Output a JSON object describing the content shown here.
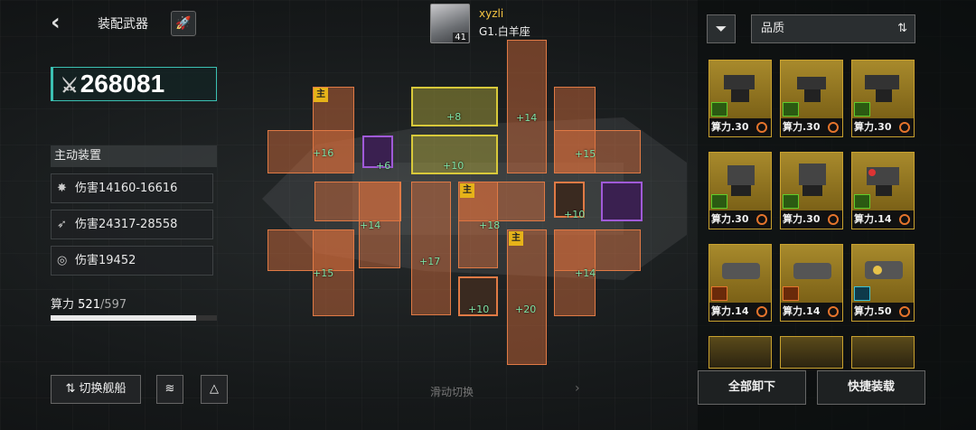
{
  "header": {
    "back_icon": "chevron-left-icon",
    "title": "装配武器",
    "player_name": "xyzli",
    "player_level": "41",
    "player_rank": "G1.白羊座"
  },
  "power": {
    "value": "268081"
  },
  "active": {
    "title": "主动装置",
    "stats": [
      {
        "icon": "missile-cluster-icon",
        "text": "伤害14160-16616"
      },
      {
        "icon": "torpedo-icon",
        "text": "伤害24317-28558"
      },
      {
        "icon": "plasma-ring-icon",
        "text": "伤害19452"
      }
    ]
  },
  "capacity": {
    "label": "算力",
    "used": "521",
    "total": "/597",
    "fraction": 0.873
  },
  "buttons": {
    "switch_ship": "切换舰船",
    "slide_switch": "滑动切换",
    "unload_all": "全部卸下",
    "quick_equip": "快捷装载"
  },
  "slots": {
    "main_tag": "主",
    "values": [
      "+16",
      "+6",
      "+8",
      "+10",
      "+14",
      "+15",
      "+14",
      "+17",
      "+18",
      "+10",
      "+15",
      "+10",
      "+20",
      "+14"
    ]
  },
  "sort": {
    "label": "品质"
  },
  "cards": [
    {
      "text": "算力.30"
    },
    {
      "text": "算力.30"
    },
    {
      "text": "算力.30"
    },
    {
      "text": "算力.30"
    },
    {
      "text": "算力.30"
    },
    {
      "text": "算力.14"
    },
    {
      "text": "算力.14"
    },
    {
      "text": "算力.14"
    },
    {
      "text": "算力.50"
    }
  ],
  "colors": {
    "accent": "#3bc1b3",
    "slot": "#e07a45",
    "module": "#d8c93a",
    "gold": "#c8a12e",
    "purple": "#a05ad8"
  }
}
